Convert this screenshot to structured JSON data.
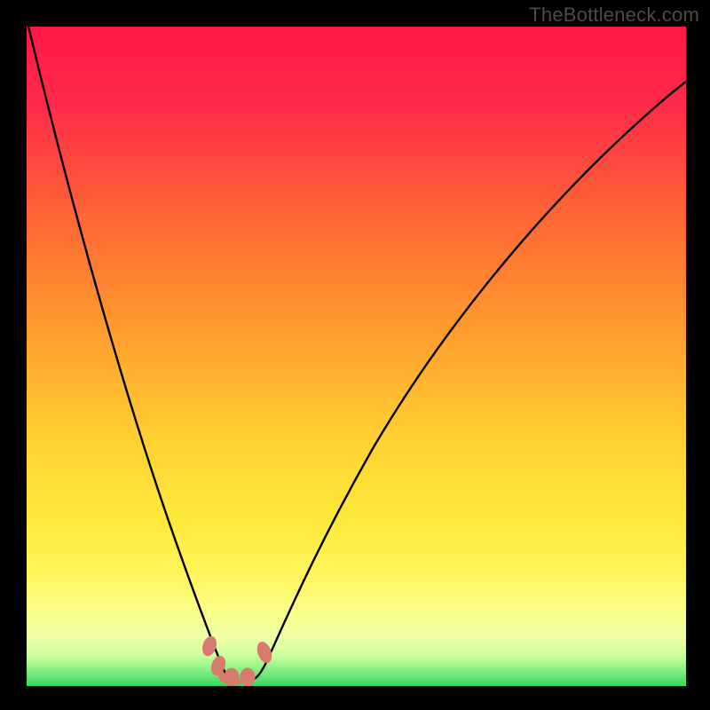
{
  "watermark": "TheBottleneck.com",
  "colors": {
    "top": "#ff1744",
    "orange": "#ff7a2a",
    "yellow": "#ffe93b",
    "lightyellow": "#fdff8a",
    "pale": "#f4ffb0",
    "green": "#3ddc67",
    "marker": "#d87a6e",
    "line": "#000000",
    "frame": "#000000"
  },
  "chart_data": {
    "type": "line",
    "title": "",
    "xlabel": "",
    "ylabel": "",
    "xlim": [
      0,
      1
    ],
    "ylim": [
      0,
      1
    ],
    "note": "Axes not labeled in image; x/y normalized 0–1. y ≈ bottleneck mismatch (0 = optimal, 1 = worst).",
    "curves": [
      {
        "name": "left-branch",
        "x": [
          0.0,
          0.03,
          0.06,
          0.09,
          0.12,
          0.15,
          0.18,
          0.21,
          0.24,
          0.262,
          0.28,
          0.3
        ],
        "y": [
          1.0,
          0.86,
          0.73,
          0.61,
          0.5,
          0.395,
          0.3,
          0.21,
          0.12,
          0.06,
          0.03,
          0.0
        ]
      },
      {
        "name": "right-branch",
        "x": [
          0.355,
          0.38,
          0.42,
          0.47,
          0.53,
          0.6,
          0.68,
          0.77,
          0.87,
          0.94,
          1.0
        ],
        "y": [
          0.0,
          0.055,
          0.14,
          0.24,
          0.34,
          0.44,
          0.53,
          0.615,
          0.695,
          0.74,
          0.775
        ]
      }
    ],
    "trough": {
      "x": [
        0.28,
        0.3,
        0.32,
        0.34,
        0.36
      ],
      "y": [
        0.03,
        0.01,
        0.006,
        0.01,
        0.04
      ]
    },
    "markers": {
      "note": "pink lozenge markers visible near trough",
      "points": [
        {
          "x": 0.278,
          "y": 0.06
        },
        {
          "x": 0.292,
          "y": 0.03
        },
        {
          "x": 0.312,
          "y": 0.012
        },
        {
          "x": 0.335,
          "y": 0.012
        },
        {
          "x": 0.36,
          "y": 0.052
        }
      ]
    },
    "gradient_bands": [
      {
        "y0": 1.0,
        "y1": 0.24,
        "from": "#ff1744",
        "to": "#ffe93b"
      },
      {
        "y0": 0.24,
        "y1": 0.12,
        "from": "#ffe93b",
        "to": "#fdff8a"
      },
      {
        "y0": 0.12,
        "y1": 0.055,
        "from": "#fdff8a",
        "to": "#f4ffb0"
      },
      {
        "y0": 0.055,
        "y1": 0.0,
        "from": "#f4ffb0",
        "to": "#3ddc67"
      }
    ]
  }
}
